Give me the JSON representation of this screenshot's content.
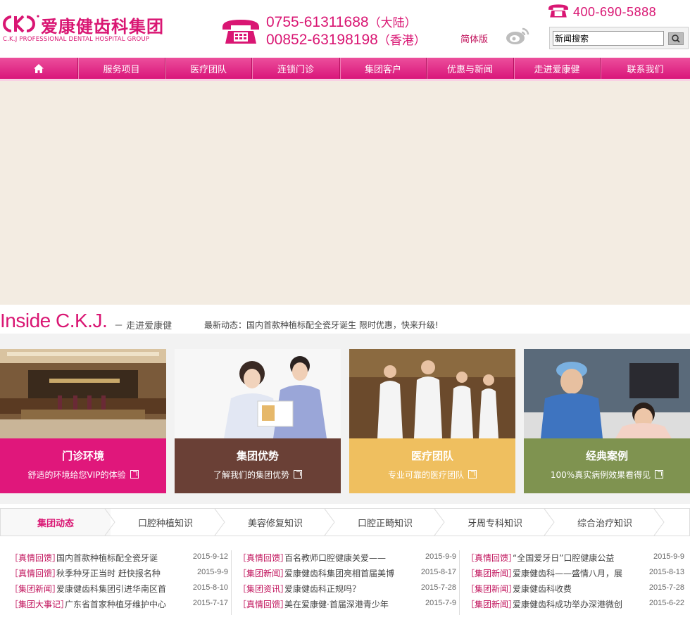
{
  "colors": {
    "brand": "#d91673",
    "card_pink": "#e0177b",
    "card_brown": "#6a4036",
    "card_yellow": "#efbf5f",
    "card_olive": "#7f9350"
  },
  "header": {
    "logo_cn": "爱康健齿科集团",
    "logo_en": "C.K.J PROFESSIONAL DENTAL HOSPITAL GROUP",
    "hotlines": [
      {
        "number": "0755-61311688",
        "region": "（大陆）"
      },
      {
        "number": "00852-63198198",
        "region": "（香港）"
      }
    ],
    "hotline_400": "400-690-5888",
    "language": "简体版",
    "search": {
      "value": "新闻搜索"
    },
    "icons": [
      "phone-icon",
      "weibo-icon",
      "search-icon"
    ]
  },
  "nav": {
    "items": [
      {
        "label": "",
        "icon": "home-icon"
      },
      {
        "label": "服务项目"
      },
      {
        "label": "医疗团队"
      },
      {
        "label": "连锁门诊"
      },
      {
        "label": "集团客户"
      },
      {
        "label": "优惠与新闻"
      },
      {
        "label": "走进爱康健"
      },
      {
        "label": "联系我们"
      }
    ]
  },
  "inside": {
    "title": "Inside C.K.J.",
    "subtitle": "－ 走进爱康健",
    "news_label": "最新动态：",
    "news_text": "国内首款种植标配全瓷牙诞生 限时优惠，快来升级!"
  },
  "cards": [
    {
      "title": "门诊环境",
      "desc": "舒适的环境给您VIP的体验"
    },
    {
      "title": "集团优势",
      "desc": "了解我们的集团优势"
    },
    {
      "title": "医疗团队",
      "desc": "专业可靠的医疗团队"
    },
    {
      "title": "经典案例",
      "desc": "100%真实病例效果看得见"
    }
  ],
  "tabs": [
    "集团动态",
    "口腔种植知识",
    "美容修复知识",
    "口腔正畸知识",
    "牙周专科知识",
    "综合治疗知识"
  ],
  "news": [
    [
      {
        "cat": "［真情回馈］",
        "title": "国内首款种植标配全瓷牙诞",
        "date": "2015-9-12"
      },
      {
        "cat": "［真情回馈］",
        "title": "秋季种牙正当时 赶快报名种",
        "date": "2015-9-9"
      },
      {
        "cat": "［集团新闻］",
        "title": "爱康健齿科集团引进华南区首",
        "date": "2015-8-10"
      },
      {
        "cat": "［集团大事记］",
        "title": "广东省首家种植牙维护中心",
        "date": "2015-7-17"
      }
    ],
    [
      {
        "cat": "［真情回馈］",
        "title": "百名教师口腔健康关爱——",
        "date": "2015-9-9"
      },
      {
        "cat": "［集团新闻］",
        "title": "爱康健齿科集团亮相首届美博",
        "date": "2015-8-17"
      },
      {
        "cat": "［集团资讯］",
        "title": "爱康健齿科正规吗？",
        "date": "2015-7-28"
      },
      {
        "cat": "［真情回馈］",
        "title": "美在爱康健·首届深港青少年",
        "date": "2015-7-9"
      }
    ],
    [
      {
        "cat": "［真情回馈］",
        "title": "“全国爱牙日”口腔健康公益",
        "date": "2015-9-9"
      },
      {
        "cat": "［集团新闻］",
        "title": "爱康健齿科——盛情八月，展",
        "date": "2015-8-13"
      },
      {
        "cat": "［集团新闻］",
        "title": "爱康健齿科收费",
        "date": "2015-7-28"
      },
      {
        "cat": "［集团新闻］",
        "title": "爱康健齿科成功举办深港微创",
        "date": "2015-6-22"
      }
    ]
  ]
}
